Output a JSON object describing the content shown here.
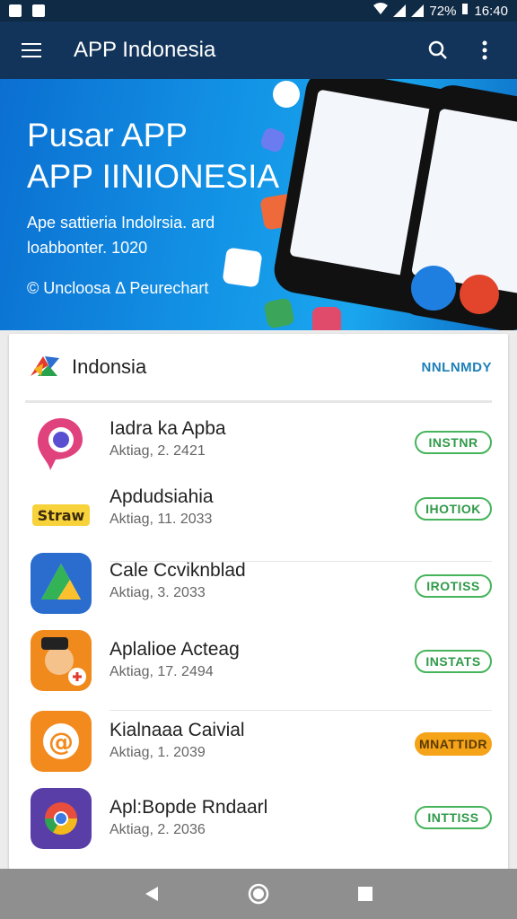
{
  "status": {
    "battery": "72%",
    "time": "16:40"
  },
  "appbar": {
    "title": "APP Indonesia"
  },
  "hero": {
    "headline_line1": "Pusar APP",
    "headline_line2": "APP IINIONESIA",
    "description": "Ape sattieria Indolrsia. ard loabbonter. 1020",
    "cta": "© Uncloosa Δ Peurechart"
  },
  "card": {
    "title": "Indonsia",
    "action_label": "NNLNMDY"
  },
  "apps": [
    {
      "name": "Iadra ka Apba",
      "date": "Aktiag, 2. 2421",
      "button": "INSTNR",
      "icon": "map-pin-app-icon",
      "button_style": "outline"
    },
    {
      "name": "Apdudsiahia",
      "date": "Aktiag, 11. 2033",
      "button": "IHOTIOK",
      "icon": "strawberry-logo-icon",
      "button_style": "outline"
    },
    {
      "name": "Cale Ccviknblad",
      "date": "Aktiag, 3. 2033",
      "button": "IROTISS",
      "icon": "drive-triangle-icon",
      "button_style": "outline"
    },
    {
      "name": "Aplalioe Acteag",
      "date": "Aktiag, 17. 2494",
      "button": "INSTATS",
      "icon": "cartoon-character-icon",
      "button_style": "outline"
    },
    {
      "name": "Kialnaaa Caivial",
      "date": "Aktiag, 1. 2039",
      "button": "MNATTIDR",
      "icon": "at-sign-app-icon",
      "button_style": "filled"
    },
    {
      "name": "Apl:Bopde Rndaarl",
      "date": "Aktiag, 2. 2036",
      "button": "INTTISS",
      "icon": "chrome-like-app-icon",
      "button_style": "outline"
    }
  ],
  "colors": {
    "appbar": "#12345a",
    "hero_blue": "#1394e6",
    "install_green": "#45b45b",
    "update_orange": "#f5a318",
    "link_blue": "#1c7fb8"
  }
}
